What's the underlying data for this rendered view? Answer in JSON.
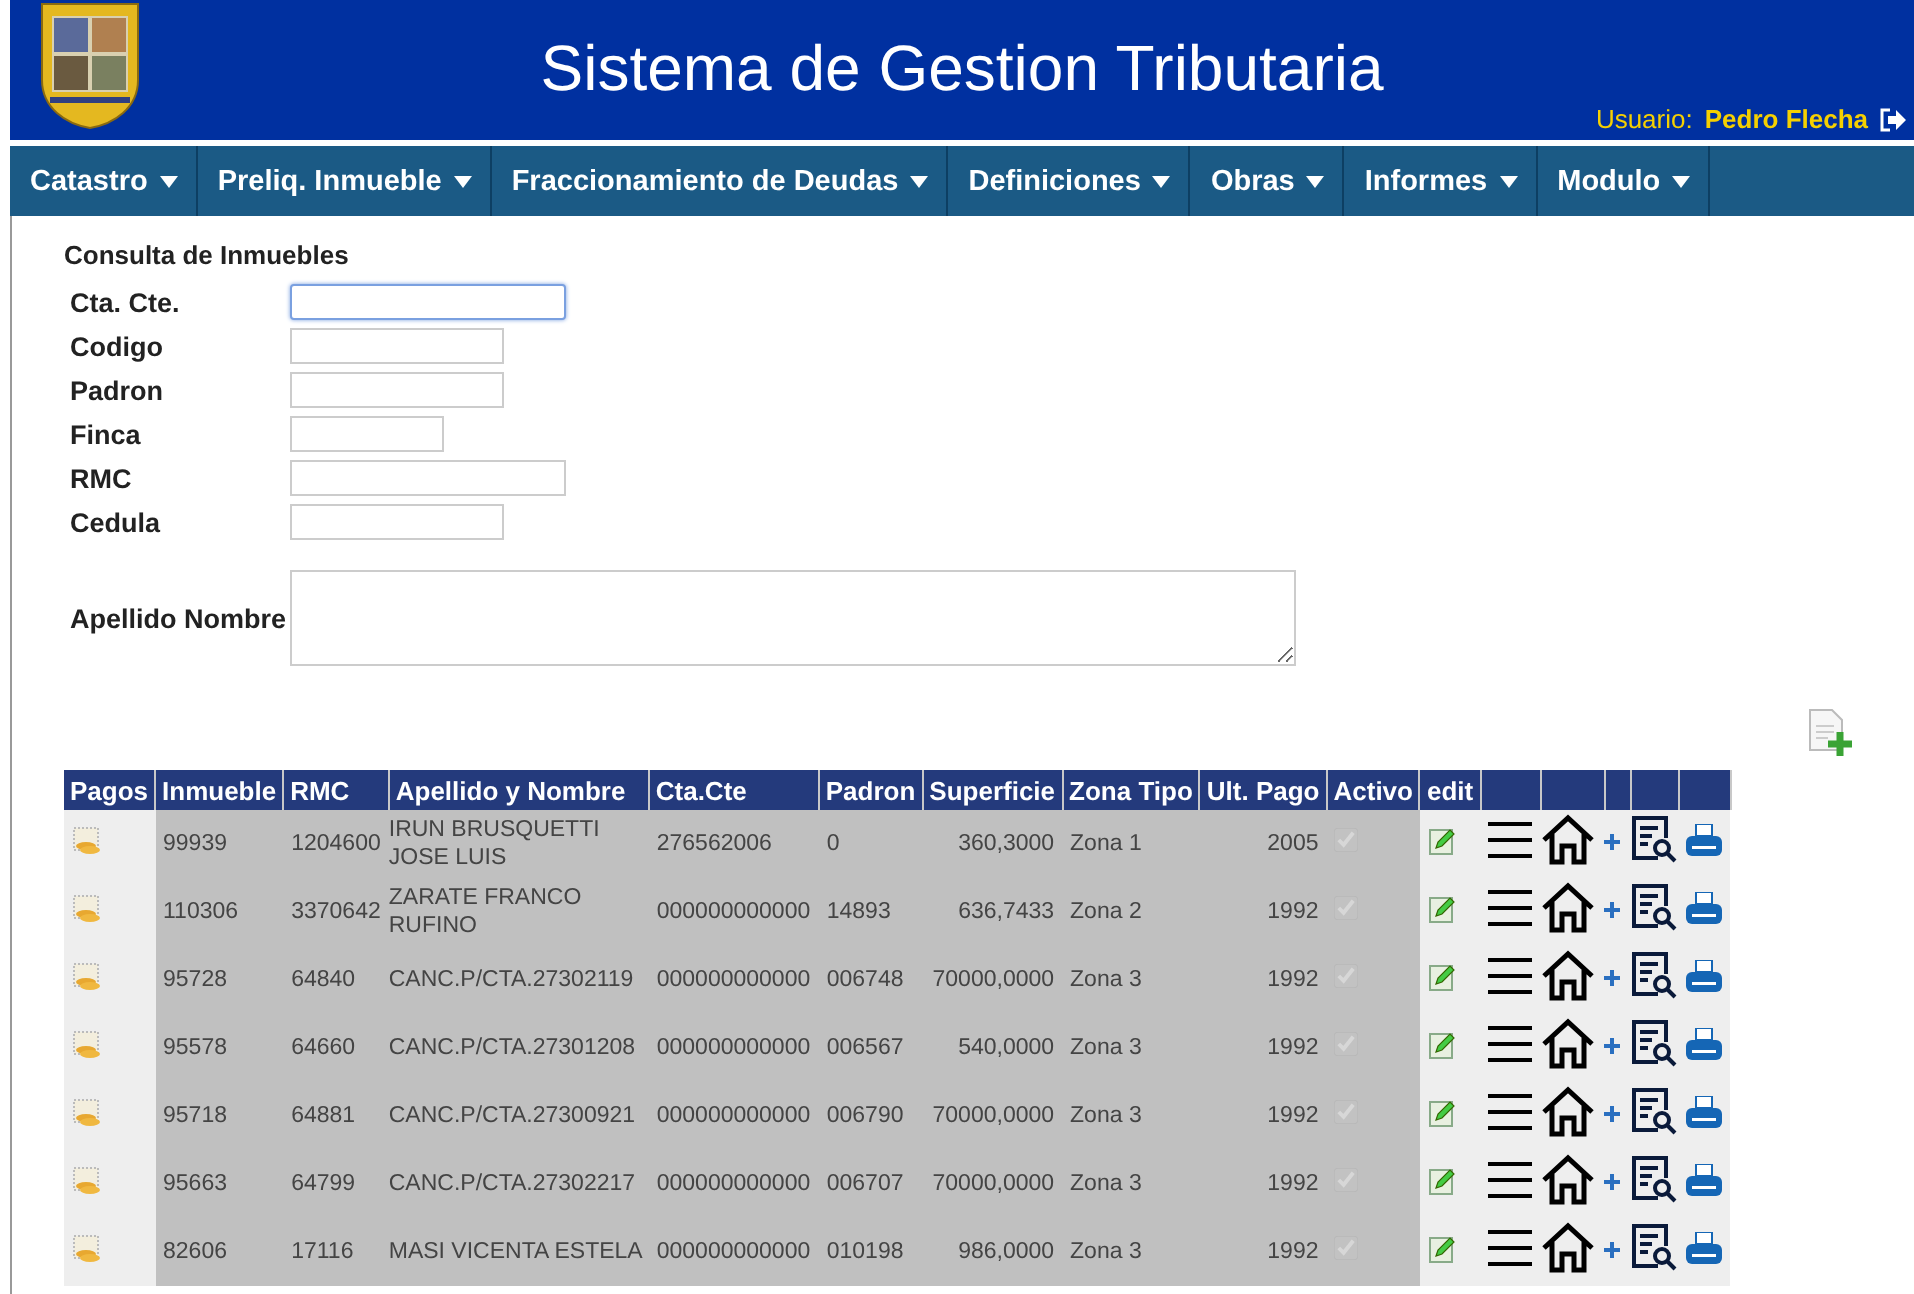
{
  "header": {
    "title": "Sistema de Gestion Tributaria",
    "user_label": "Usuario:",
    "user_name": "Pedro Flecha"
  },
  "nav": [
    {
      "label": "Catastro"
    },
    {
      "label": "Preliq. Inmueble"
    },
    {
      "label": "Fraccionamiento de Deudas"
    },
    {
      "label": "Definiciones"
    },
    {
      "label": "Obras"
    },
    {
      "label": "Informes"
    },
    {
      "label": "Modulo"
    }
  ],
  "form": {
    "title": "Consulta de Inmuebles",
    "fields": [
      {
        "label": "Cta. Cte.",
        "kind": "input",
        "focused": true
      },
      {
        "label": "Codigo",
        "kind": "input",
        "focused": false
      },
      {
        "label": "Padron",
        "kind": "input",
        "focused": false
      },
      {
        "label": "Finca",
        "kind": "input",
        "focused": false
      },
      {
        "label": "RMC",
        "kind": "input",
        "focused": false
      },
      {
        "label": "Cedula",
        "kind": "input",
        "focused": false
      },
      {
        "label": "Apellido Nombre",
        "kind": "textarea",
        "focused": false
      }
    ]
  },
  "table": {
    "columns": [
      "Pagos",
      "Inmueble",
      "RMC",
      "Apellido y Nombre",
      "Cta.Cte",
      "Padron",
      "Superficie",
      "Zona Tipo",
      "Ult. Pago",
      "Activo",
      "edit"
    ],
    "rows": [
      {
        "inmueble": "99939",
        "rmc": "1204600",
        "nombre": "IRUN BRUSQUETTI JOSE LUIS",
        "cta_cte": "276562006",
        "padron": "0",
        "superficie": "360,3000",
        "zona_tipo": "Zona 1",
        "ult_pago": "2005",
        "activo": true
      },
      {
        "inmueble": "110306",
        "rmc": "3370642",
        "nombre": "ZARATE FRANCO RUFINO",
        "cta_cte": "000000000000",
        "padron": "14893",
        "superficie": "636,7433",
        "zona_tipo": "Zona 2",
        "ult_pago": "1992",
        "activo": true
      },
      {
        "inmueble": "95728",
        "rmc": "64840",
        "nombre": "CANC.P/CTA.27302119",
        "cta_cte": "000000000000",
        "padron": "006748",
        "superficie": "70000,0000",
        "zona_tipo": "Zona 3",
        "ult_pago": "1992",
        "activo": true
      },
      {
        "inmueble": "95578",
        "rmc": "64660",
        "nombre": "CANC.P/CTA.27301208",
        "cta_cte": "000000000000",
        "padron": "006567",
        "superficie": "540,0000",
        "zona_tipo": "Zona 3",
        "ult_pago": "1992",
        "activo": true
      },
      {
        "inmueble": "95718",
        "rmc": "64881",
        "nombre": "CANC.P/CTA.27300921",
        "cta_cte": "000000000000",
        "padron": "006790",
        "superficie": "70000,0000",
        "zona_tipo": "Zona 3",
        "ult_pago": "1992",
        "activo": true
      },
      {
        "inmueble": "95663",
        "rmc": "64799",
        "nombre": "CANC.P/CTA.27302217",
        "cta_cte": "000000000000",
        "padron": "006707",
        "superficie": "70000,0000",
        "zona_tipo": "Zona 3",
        "ult_pago": "1992",
        "activo": true
      },
      {
        "inmueble": "82606",
        "rmc": "17116",
        "nombre": "MASI VICENTA ESTELA",
        "cta_cte": "000000000000",
        "padron": "010198",
        "superficie": "986,0000",
        "zona_tipo": "Zona 3",
        "ult_pago": "1992",
        "activo": true
      }
    ]
  }
}
